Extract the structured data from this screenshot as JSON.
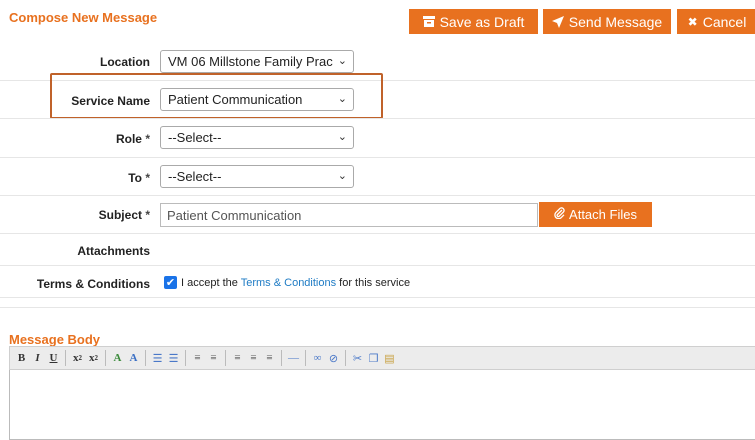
{
  "page": {
    "title": "Compose New Message"
  },
  "toolbar": {
    "save_draft": "Save as Draft",
    "send_message": "Send Message",
    "cancel": "Cancel"
  },
  "form": {
    "location": {
      "label": "Location",
      "value": "VM 06 Millstone Family Prac"
    },
    "service_name": {
      "label": "Service Name",
      "value": "Patient Communication"
    },
    "role": {
      "label": "Role",
      "required": "*",
      "value": "--Select--"
    },
    "to": {
      "label": "To",
      "required": "*",
      "value": "--Select--"
    },
    "subject": {
      "label": "Subject",
      "required": "*",
      "value": "Patient Communication"
    },
    "attach_files": "Attach Files",
    "attachments": {
      "label": "Attachments"
    },
    "terms": {
      "label": "Terms & Conditions",
      "checked": true,
      "text_before": "I accept the ",
      "link": "Terms & Conditions",
      "text_after": " for this service"
    }
  },
  "message_body": {
    "title": "Message Body",
    "editor_buttons": [
      "bold",
      "italic",
      "underline",
      "superscript",
      "subscript",
      "text-color",
      "background-color",
      "ordered-list",
      "unordered-list",
      "outdent",
      "indent",
      "align-left",
      "align-center",
      "align-right",
      "horizontal-rule",
      "link",
      "unlink",
      "cut",
      "copy",
      "paste"
    ]
  },
  "colors": {
    "accent": "#e8711f",
    "highlight_border": "#c0622a",
    "link": "#1e7bc4"
  }
}
